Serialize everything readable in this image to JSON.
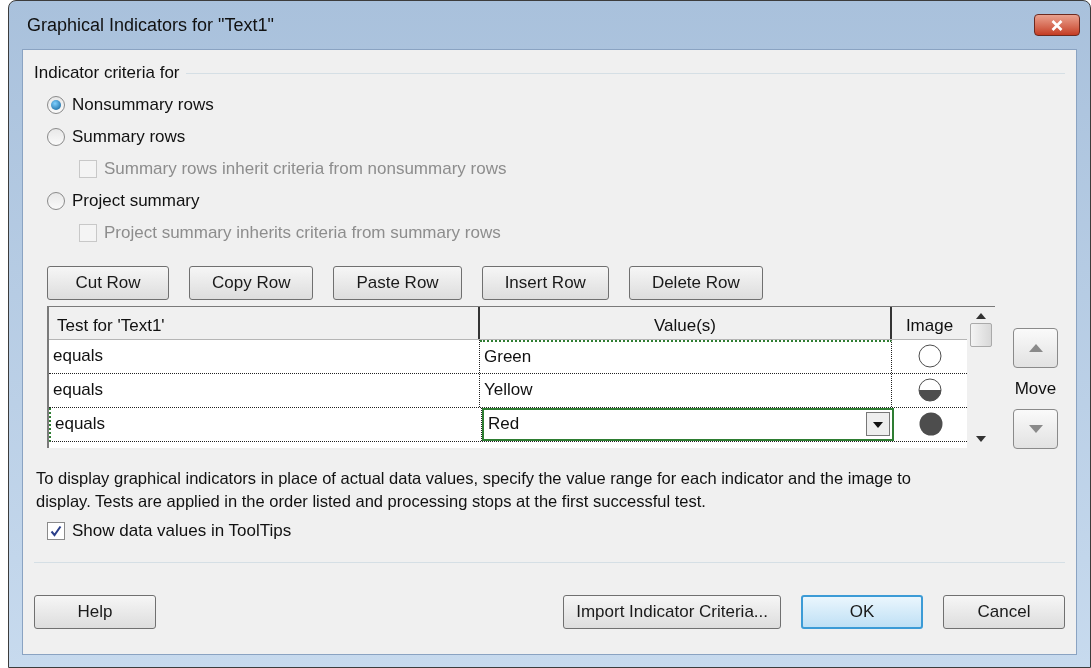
{
  "window": {
    "title": "Graphical Indicators for \"Text1\""
  },
  "criteria": {
    "label": "Indicator criteria for",
    "options": [
      {
        "label": "Nonsummary rows",
        "selected": true
      },
      {
        "label": "Summary rows",
        "selected": false,
        "sub_checkbox": {
          "label": "Summary rows inherit criteria from nonsummary rows",
          "checked": false,
          "disabled": true
        }
      },
      {
        "label": "Project summary",
        "selected": false,
        "sub_checkbox": {
          "label": "Project summary inherits criteria from summary rows",
          "checked": false,
          "disabled": true
        }
      }
    ]
  },
  "row_buttons": [
    "Cut Row",
    "Copy Row",
    "Paste Row",
    "Insert Row",
    "Delete Row"
  ],
  "table": {
    "columns": [
      "Test for 'Text1'",
      "Value(s)",
      "Image"
    ],
    "rows": [
      {
        "test": "equals",
        "value": "Green",
        "kind": "empty",
        "selected": false
      },
      {
        "test": "equals",
        "value": "Yellow",
        "kind": "half",
        "selected": false
      },
      {
        "test": "equals",
        "value": "Red",
        "kind": "full",
        "selected": true
      }
    ]
  },
  "move_label": "Move",
  "description": "To display graphical indicators in place of actual data values, specify the value range for each indicator and the image to display.  Tests are applied in the order listed and processing stops at the first successful test.",
  "tooltips_checkbox": {
    "label": "Show data values in ToolTips",
    "checked": true
  },
  "footer_buttons": [
    {
      "label": "Help",
      "default": false
    },
    {
      "label": "Import Indicator Criteria...",
      "default": false
    },
    {
      "label": "OK",
      "default": true
    },
    {
      "label": "Cancel",
      "default": false
    }
  ]
}
